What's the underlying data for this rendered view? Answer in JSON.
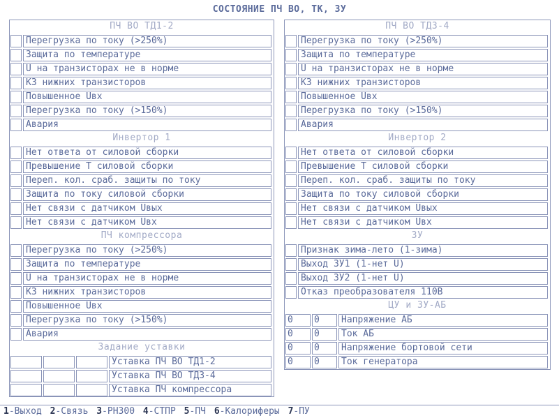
{
  "title": "СОСТОЯНИЕ ПЧ ВО, ТК, ЗУ",
  "left": {
    "sec1": {
      "header": "ПЧ ВО ТД1-2",
      "items": [
        "Перегрузка по току (>250%)",
        "Защита по температуре",
        "U на транзисторах не в норме",
        "КЗ нижних транзисторов",
        "Повышенное Uвх",
        "Перегрузка по току (>150%)",
        "Авария"
      ]
    },
    "sec2": {
      "header": "Инвертор 1",
      "items": [
        "Нет ответа от силовой сборки",
        "Превышение T силовой сборки",
        "Переп. кол. сраб. защиты по току",
        "Защита по току силовой сборки",
        "Нет связи с датчиком Uвых",
        "Нет связи с датчиком Uвх"
      ]
    },
    "sec3": {
      "header": "ПЧ компрессора",
      "items": [
        "Перегрузка по току (>250%)",
        "Защита по температуре",
        "U на транзисторах не в норме",
        "КЗ нижних транзисторов",
        "Повышенное Uвх",
        "Перегрузка по току (>150%)",
        "Авария"
      ]
    },
    "sec4": {
      "header": "Задание уставки",
      "items": [
        "Уставка ПЧ ВО ТД1-2",
        "Уставка ПЧ ВО ТД3-4",
        "Уставка ПЧ компрессора"
      ]
    }
  },
  "right": {
    "sec1": {
      "header": "ПЧ ВО ТД3-4",
      "items": [
        "Перегрузка по току (>250%)",
        "Защита по температуре",
        "U на транзисторах не в норме",
        "КЗ нижних транзисторов",
        "Повышенное Uвх",
        "Перегрузка по току (>150%)",
        "Авария"
      ]
    },
    "sec2": {
      "header": "Инвертор 2",
      "items": [
        "Нет ответа от силовой сборки",
        "Превышение T силовой сборки",
        "Переп. кол. сраб. защиты по току",
        "Защита по току силовой сборки",
        "Нет связи с датчиком Uвых",
        "Нет связи с датчиком Uвх"
      ]
    },
    "sec3": {
      "header": "ЗУ",
      "items": [
        "Признак зима-лето (1-зима)",
        "Выход ЗУ1 (1-нет U)",
        "Выход ЗУ2 (1-нет U)",
        "Отказ преобразователя 110В"
      ]
    },
    "sec4": {
      "header": "ЦУ и ЗУ-АБ",
      "rows": [
        {
          "v1": "0",
          "v2": "0",
          "label": "Напряжение АБ"
        },
        {
          "v1": "0",
          "v2": "0",
          "label": "Ток АБ"
        },
        {
          "v1": "0",
          "v2": "0",
          "label": "Напряжение бортовой сети"
        },
        {
          "v1": "0",
          "v2": "0",
          "label": "Ток генератора"
        }
      ]
    }
  },
  "footer": [
    {
      "key": "1",
      "label": "-Выход"
    },
    {
      "key": "2",
      "label": "-Связь"
    },
    {
      "key": "3",
      "label": "-РН300"
    },
    {
      "key": "4",
      "label": "-СТПР"
    },
    {
      "key": "5",
      "label": "-ПЧ"
    },
    {
      "key": "6",
      "label": "-Калориферы"
    },
    {
      "key": "7",
      "label": "-ПУ"
    }
  ]
}
